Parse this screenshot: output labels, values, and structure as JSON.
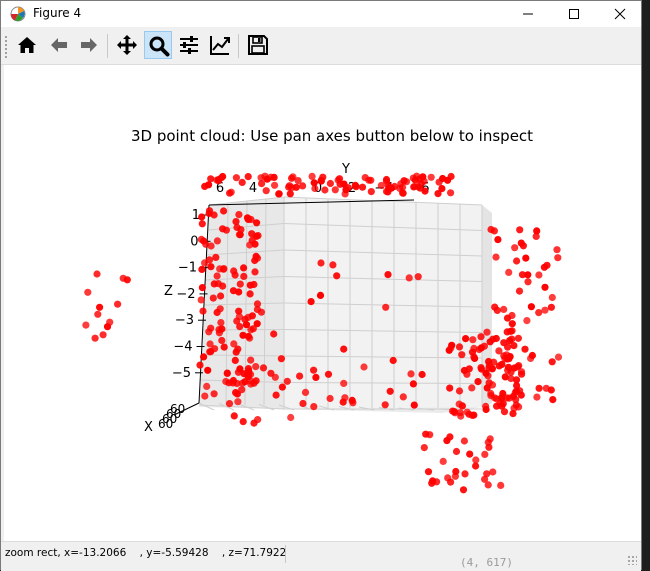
{
  "window": {
    "title": "Figure 4"
  },
  "toolbar": {
    "tools": [
      {
        "name": "home-button",
        "icon": "home-icon"
      },
      {
        "name": "back-button",
        "icon": "arrow-left-icon"
      },
      {
        "name": "forward-button",
        "icon": "arrow-right-icon"
      },
      {
        "name": "pan-button",
        "icon": "move-icon"
      },
      {
        "name": "zoom-button",
        "icon": "magnifier-icon",
        "active": true
      },
      {
        "name": "subplots-button",
        "icon": "sliders-icon"
      },
      {
        "name": "edit-axes-button",
        "icon": "line-chart-icon"
      },
      {
        "name": "save-button",
        "icon": "floppy-disk-icon"
      }
    ]
  },
  "plot": {
    "title": "3D point cloud: Use pan axes button below to inspect",
    "axis_labels": {
      "x": "X",
      "y": "Y",
      "z": "Z"
    },
    "z_ticks": [
      "1",
      "0",
      "−1",
      "−2",
      "−3",
      "−4",
      "−5"
    ],
    "y_ticks": [
      "6",
      "4",
      "0",
      "2",
      "−4",
      "−6"
    ],
    "x_ticks": "60",
    "point_color": "#ff0000"
  },
  "status": {
    "text": "zoom rect, x=-13.2066    , y=-5.59428    , z=71.7922"
  },
  "background": {
    "snippet": "(4,  617)"
  }
}
